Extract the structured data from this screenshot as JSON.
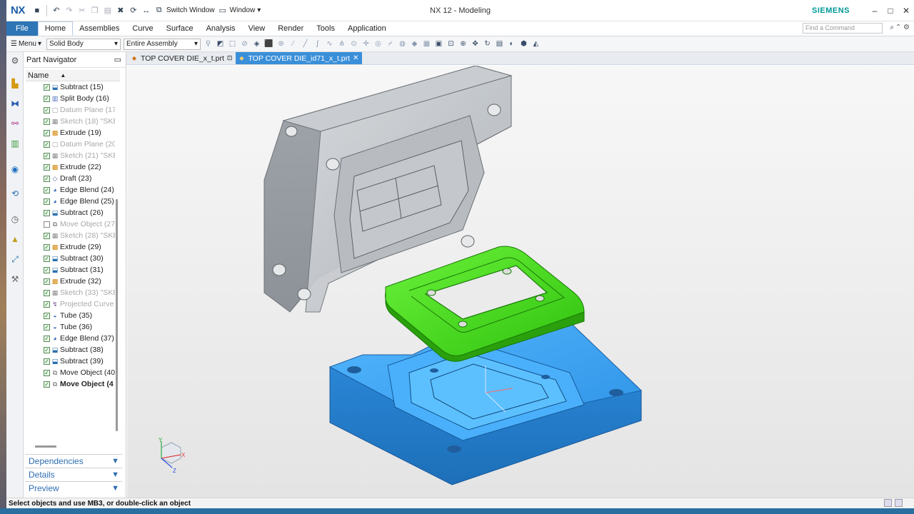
{
  "app": {
    "logo": "NX",
    "title": "NX 12 - Modeling",
    "brand": "SIEMENS",
    "quick_access": {
      "switch_window": "Switch Window",
      "window_menu": "Window"
    }
  },
  "ribbon": {
    "tabs": [
      "File",
      "Home",
      "Assemblies",
      "Curve",
      "Surface",
      "Analysis",
      "View",
      "Render",
      "Tools",
      "Application"
    ],
    "active_tab": "Home",
    "find_placeholder": "Find a Command"
  },
  "toolbar": {
    "menu_label": "Menu",
    "type_filter": "Solid Body",
    "scope_filter": "Entire Assembly"
  },
  "navigator": {
    "title": "Part Navigator",
    "column_name": "Name",
    "items": [
      {
        "label": "Subtract (15)",
        "checked": true,
        "dim": false,
        "bold": false,
        "icon": "subtract"
      },
      {
        "label": "Split Body (16)",
        "checked": true,
        "dim": false,
        "bold": false,
        "icon": "split"
      },
      {
        "label": "Datum Plane (17",
        "checked": true,
        "dim": true,
        "bold": false,
        "icon": "datum"
      },
      {
        "label": "Sketch (18) \"SKE",
        "checked": true,
        "dim": true,
        "bold": false,
        "icon": "sketch"
      },
      {
        "label": "Extrude (19)",
        "checked": true,
        "dim": false,
        "bold": false,
        "icon": "extrude"
      },
      {
        "label": "Datum Plane (20",
        "checked": true,
        "dim": true,
        "bold": false,
        "icon": "datum"
      },
      {
        "label": "Sketch (21) \"SKE",
        "checked": true,
        "dim": true,
        "bold": false,
        "icon": "sketch"
      },
      {
        "label": "Extrude (22)",
        "checked": true,
        "dim": false,
        "bold": false,
        "icon": "extrude"
      },
      {
        "label": "Draft (23)",
        "checked": true,
        "dim": false,
        "bold": false,
        "icon": "draft"
      },
      {
        "label": "Edge Blend (24)",
        "checked": true,
        "dim": false,
        "bold": false,
        "icon": "blend"
      },
      {
        "label": "Edge Blend (25)",
        "checked": true,
        "dim": false,
        "bold": false,
        "icon": "blend"
      },
      {
        "label": "Subtract (26)",
        "checked": true,
        "dim": false,
        "bold": false,
        "icon": "subtract"
      },
      {
        "label": "Move Object (27",
        "checked": false,
        "dim": true,
        "bold": false,
        "icon": "move"
      },
      {
        "label": "Sketch (28) \"SKE",
        "checked": true,
        "dim": true,
        "bold": false,
        "icon": "sketch"
      },
      {
        "label": "Extrude (29)",
        "checked": true,
        "dim": false,
        "bold": false,
        "icon": "extrude"
      },
      {
        "label": "Subtract (30)",
        "checked": true,
        "dim": false,
        "bold": false,
        "icon": "subtract"
      },
      {
        "label": "Subtract (31)",
        "checked": true,
        "dim": false,
        "bold": false,
        "icon": "subtract"
      },
      {
        "label": "Extrude (32)",
        "checked": true,
        "dim": false,
        "bold": false,
        "icon": "extrude"
      },
      {
        "label": "Sketch (33) \"SKE",
        "checked": true,
        "dim": true,
        "bold": false,
        "icon": "sketch"
      },
      {
        "label": "Projected Curve",
        "checked": true,
        "dim": true,
        "bold": false,
        "icon": "curve"
      },
      {
        "label": "Tube (35)",
        "checked": true,
        "dim": false,
        "bold": false,
        "icon": "tube"
      },
      {
        "label": "Tube (36)",
        "checked": true,
        "dim": false,
        "bold": false,
        "icon": "tube"
      },
      {
        "label": "Edge Blend (37)",
        "checked": true,
        "dim": false,
        "bold": false,
        "icon": "blend"
      },
      {
        "label": "Subtract (38)",
        "checked": true,
        "dim": false,
        "bold": false,
        "icon": "subtract"
      },
      {
        "label": "Subtract (39)",
        "checked": true,
        "dim": false,
        "bold": false,
        "icon": "subtract"
      },
      {
        "label": "Move Object (40",
        "checked": true,
        "dim": false,
        "bold": false,
        "icon": "move"
      },
      {
        "label": "Move Object (4",
        "checked": true,
        "dim": false,
        "bold": true,
        "icon": "move"
      }
    ],
    "sections": [
      "Dependencies",
      "Details",
      "Preview"
    ]
  },
  "doc_tabs": [
    {
      "label": "TOP COVER DIE_x_t.prt",
      "active": false
    },
    {
      "label": "TOP COVER DIE_id71_x_t.prt",
      "active": true
    }
  ],
  "triad": {
    "x": "X",
    "y": "Y",
    "z": "Z"
  },
  "status": {
    "message": "Select objects and use MB3, or double-click an object"
  },
  "colors": {
    "accent": "#2e75b6",
    "active_doc_tab": "#3a8fd9",
    "brand": "#009999",
    "insert_part": "#39d017",
    "core_part": "#2a8ee0",
    "cavity_part": "#a9adb2"
  }
}
